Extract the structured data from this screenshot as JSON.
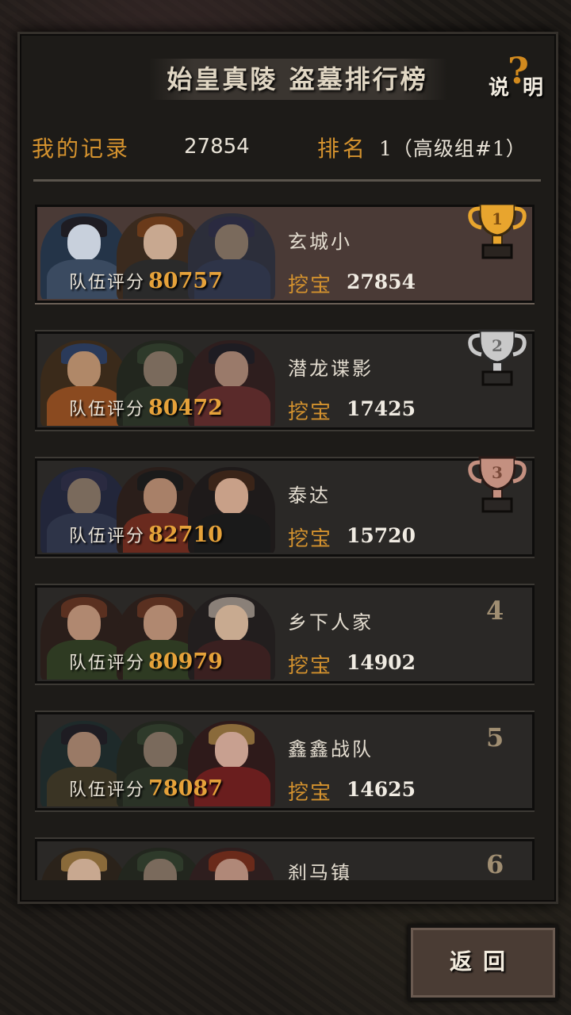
{
  "header": {
    "title": "始皇真陵 盗墓排行榜",
    "help_label": "说 明",
    "help_symbol": "?"
  },
  "my_record": {
    "label": "我的记录",
    "value": "27854",
    "rank_label": "排名",
    "rank_value": "1（高级组#1）"
  },
  "colors": {
    "accent": "#d4922e",
    "gold": "#e8a52e",
    "silver": "#c9c9c9",
    "bronze": "#c49080"
  },
  "entries": [
    {
      "team": "玄城小",
      "score_label": "队伍评分",
      "score": "80757",
      "dig_label": "挖宝",
      "dig": "27854",
      "rank": "1",
      "trophy": "gold"
    },
    {
      "team": "潜龙谍影",
      "score_label": "队伍评分",
      "score": "80472",
      "dig_label": "挖宝",
      "dig": "17425",
      "rank": "2",
      "trophy": "silver"
    },
    {
      "team": "泰达",
      "score_label": "队伍评分",
      "score": "82710",
      "dig_label": "挖宝",
      "dig": "15720",
      "rank": "3",
      "trophy": "bronze"
    },
    {
      "team": "乡下人家",
      "score_label": "队伍评分",
      "score": "80979",
      "dig_label": "挖宝",
      "dig": "14902",
      "rank": "4"
    },
    {
      "team": "鑫鑫战队",
      "score_label": "队伍评分",
      "score": "78087",
      "dig_label": "挖宝",
      "dig": "14625",
      "rank": "5"
    },
    {
      "team": "刹马镇",
      "rank": "6"
    }
  ],
  "back_button": {
    "label": "返回"
  }
}
